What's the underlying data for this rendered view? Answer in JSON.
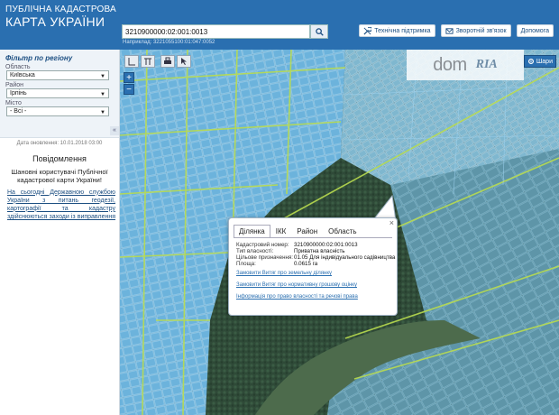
{
  "header": {
    "title_small": "ПУБЛІЧНА КАДАСТРОВА",
    "title_big": "КАРТА УКРАЇНИ",
    "search_value": "3210900000:02:001:0013",
    "search_hint": "Наприклад: 3221055100:01:047:0052",
    "links": [
      {
        "label": "Технічна підтримка",
        "icon": "wrench-icon"
      },
      {
        "label": "Зворотній зв'язок",
        "icon": "envelope-icon"
      },
      {
        "label": "Допомога",
        "icon": "help-icon"
      }
    ]
  },
  "sidebar": {
    "filter_title": "Фільтр по регіону",
    "region_label": "Область",
    "region_value": "Київська",
    "district_label": "Район",
    "district_value": "Ірпінь",
    "city_label": "Місто",
    "city_value": "- Всі -",
    "update_date": "Дата оновлення: 10.01.2018 03:00",
    "notice_title": "Повідомлення",
    "notice_greeting": "Шановні користувачі Публічної кадастрової карти України!",
    "notice_text": "На сьогодні Державною службою України з питань геодезії, картографії та кадастру здійснюються заходи із виправлення помилок"
  },
  "map": {
    "layers_label": "Шари",
    "zoom_in": "+",
    "zoom_out": "−",
    "watermark_left": "dom",
    "watermark_right": "RIA",
    "colors": {
      "parcel": "#5aa8d8",
      "road": "#b5d84a",
      "ground": "#3d5a48"
    }
  },
  "popup": {
    "close": "×",
    "tabs": [
      "Ділянка",
      "ІКК",
      "Район",
      "Область"
    ],
    "active_tab": "Ділянка",
    "fields": [
      {
        "key": "Кадастровий номер:",
        "value": "3210900000:02:001:0013"
      },
      {
        "key": "Тип власності:",
        "value": "Приватна власність"
      },
      {
        "key": "Цільове призначення:",
        "value": "01.05 Для індивідуального садівництва"
      },
      {
        "key": "Площа:",
        "value": "0.0615 га"
      }
    ],
    "links": [
      "Замовити Витяг про земельну ділянку",
      "Замовити Витяг про нормативну грошову оцінку",
      "Інформація про право власності та речові права"
    ]
  }
}
